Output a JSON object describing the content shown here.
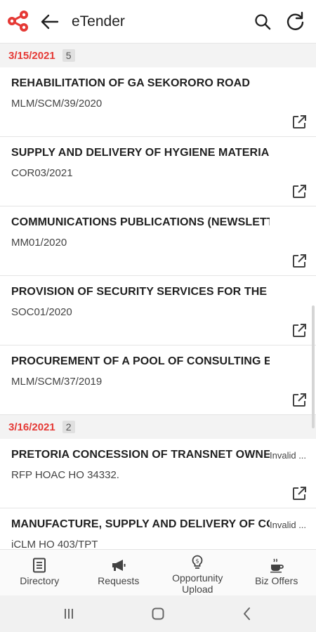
{
  "app": {
    "title": "eTender",
    "brand_color": "#e53935",
    "icons": [
      "share-logo-icon",
      "back-arrow-icon",
      "search-icon",
      "refresh-icon"
    ]
  },
  "groups": [
    {
      "date": "3/15/2021",
      "count": "5",
      "items": [
        {
          "title": "REHABILITATION OF GA SEKORORO ROAD",
          "ref": "MLM/SCM/39/2020",
          "status": ""
        },
        {
          "title": "SUPPLY AND DELIVERY OF HYGIENE MATERIALS",
          "ref": "COR03/2021",
          "status": ""
        },
        {
          "title": "COMMUNICATIONS PUBLICATIONS (NEWSLETTER",
          "ref": "MM01/2020",
          "status": ""
        },
        {
          "title": "PROVISION OF SECURITY SERVICES FOR THE P",
          "ref": "SOC01/2020",
          "status": ""
        },
        {
          "title": "PROCUREMENT OF A POOL OF CONSULTING EN",
          "ref": "MLM/SCM/37/2019",
          "status": ""
        }
      ]
    },
    {
      "date": "3/16/2021",
      "count": "2",
      "items": [
        {
          "title": "PRETORIA CONCESSION OF TRANSNET OWNED",
          "ref": "RFP HOAC HO 34332.",
          "status": "Invalid ..."
        },
        {
          "title": "MANUFACTURE, SUPPLY AND DELIVERY OF CO",
          "ref": "iCLM HO 403/TPT",
          "status": "Invalid ..."
        }
      ]
    }
  ],
  "bottom_nav": [
    {
      "label": "Directory",
      "icon": "directory-icon"
    },
    {
      "label": "Requests",
      "icon": "megaphone-icon"
    },
    {
      "label": "Opportunity Upload",
      "icon": "lightbulb-icon"
    },
    {
      "label": "Biz Offers",
      "icon": "coffee-cup-icon"
    }
  ],
  "system_nav": [
    "recent-apps-icon",
    "home-icon",
    "back-icon"
  ]
}
